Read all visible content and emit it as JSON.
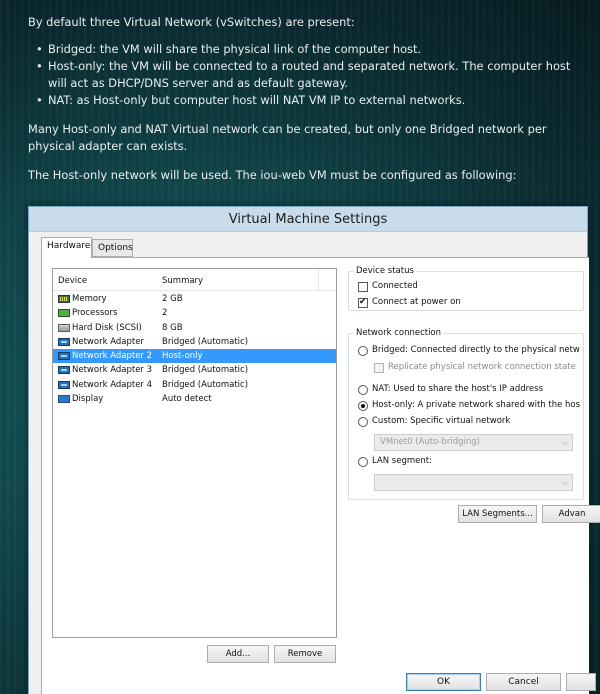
{
  "article": {
    "intro": "By default three Virtual Network (vSwitches) are present:",
    "bullets": [
      "Bridged: the VM will share the physical link of the computer host.",
      "Host-only: the VM will be connected to a routed and separated network. The computer host will act as DHCP/DNS server and as default gateway.",
      "NAT: as Host-only but computer host will NAT VM IP to external networks."
    ],
    "para2": "Many Host-only and NAT Virtual network can be created, but only one Bridged network per physical adapter can exists.",
    "para3": "The Host-only network will be used. The iou-web VM must be configured as following:"
  },
  "dialog": {
    "title": "Virtual Machine Settings",
    "tabs": [
      "Hardware",
      "Options"
    ],
    "device_list": {
      "headers": {
        "device": "Device",
        "summary": "Summary"
      },
      "rows": [
        {
          "device": "Memory",
          "summary": "2 GB",
          "icon": "memory-icon"
        },
        {
          "device": "Processors",
          "summary": "2",
          "icon": "processor-icon"
        },
        {
          "device": "Hard Disk (SCSI)",
          "summary": "8 GB",
          "icon": "hard-disk-icon"
        },
        {
          "device": "Network Adapter",
          "summary": "Bridged (Automatic)",
          "icon": "network-adapter-icon"
        },
        {
          "device": "Network Adapter 2",
          "summary": "Host-only",
          "icon": "network-adapter-icon",
          "selected": true
        },
        {
          "device": "Network Adapter 3",
          "summary": "Bridged (Automatic)",
          "icon": "network-adapter-icon"
        },
        {
          "device": "Network Adapter 4",
          "summary": "Bridged (Automatic)",
          "icon": "network-adapter-icon"
        },
        {
          "device": "Display",
          "summary": "Auto detect",
          "icon": "display-icon"
        }
      ]
    },
    "add_button": "Add...",
    "remove_button": "Remove",
    "device_status": {
      "legend": "Device status",
      "connected": {
        "label": "Connected",
        "checked": false
      },
      "connect_at_power_on": {
        "label": "Connect at power on",
        "checked": true
      }
    },
    "network_connection": {
      "legend": "Network connection",
      "bridged": "Bridged: Connected directly to the physical netw",
      "replicate": "Replicate physical network connection state",
      "nat": "NAT: Used to share the host's IP address",
      "host_only": "Host-only: A private network shared with the hos",
      "custom": "Custom: Specific virtual network",
      "vmnet_select": "VMnet0 (Auto-bridging)",
      "lan_segment": "LAN segment:",
      "lan_select": "",
      "selected": "host-only"
    },
    "lan_segments_button": "LAN Segments...",
    "advanced_button": "Advan",
    "ok_button": "OK",
    "cancel_button": "Cancel",
    "help_button": ""
  }
}
